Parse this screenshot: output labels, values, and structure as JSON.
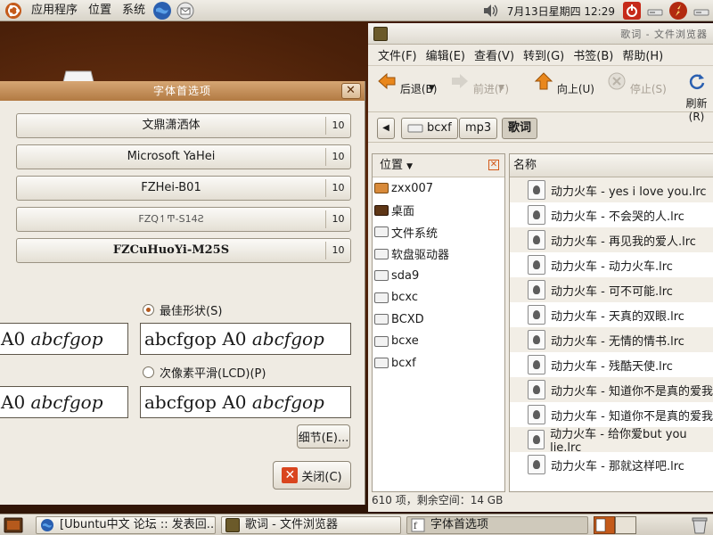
{
  "top_panel": {
    "menus": [
      "应用程序",
      "位置",
      "系统"
    ],
    "clock": "7月13日星期四 12:29"
  },
  "font_prefs": {
    "title": "字体首选项",
    "fonts": [
      {
        "name": "文鼎潇洒体",
        "size": "10"
      },
      {
        "name": "Microsoft YaHei",
        "size": "10"
      },
      {
        "name": "FZHei-B01",
        "size": "10"
      },
      {
        "name": "FZQ↿Ͳ-S14Ƨ",
        "size": "10"
      },
      {
        "name": "FZCuHuoYi-M25S",
        "size": "10"
      }
    ],
    "rendering": {
      "best_shapes": "最佳形状(S)",
      "subpixel": "次像素平滑(LCD)(P)"
    },
    "preview_text_a": "A0 ",
    "preview_text_b": "abcfgop",
    "preview_text_c": "abcfgop ",
    "preview_text_d": "A0 ",
    "details_button": "细节(E)...",
    "close_button": "关闭(C)"
  },
  "file_browser": {
    "title": "歌词 - 文件浏览器",
    "menu": [
      "文件(F)",
      "编辑(E)",
      "查看(V)",
      "转到(G)",
      "书签(B)",
      "帮助(H)"
    ],
    "toolbar": {
      "back": "后退(B)",
      "forward": "前进(F)",
      "up": "向上(U)",
      "stop": "停止(S)",
      "refresh": "刷新(R)"
    },
    "breadcrumbs": [
      "bcxf",
      "mp3",
      "歌词"
    ],
    "sidebar": {
      "header": "位置",
      "items": [
        "zxx007",
        "桌面",
        "文件系统",
        "软盘驱动器",
        "sda9",
        "bcxc",
        "BCXD",
        "bcxe",
        "bcxf"
      ]
    },
    "list": {
      "column": "名称",
      "files": [
        "动力火车 - yes i love you.lrc",
        "动力火车 - 不会哭的人.lrc",
        "动力火车 - 再见我的爱人.lrc",
        "动力火车 - 动力火车.lrc",
        "动力火车 - 可不可能.lrc",
        "动力火车 - 天真的双眼.lrc",
        "动力火车 - 无情的情书.lrc",
        "动力火车 - 残酷天使.lrc",
        "动力火车 - 知道你不是真的爱我",
        "动力火车 - 知道你不是真的爱我",
        "动力火车 - 给你爱but you lie.lrc",
        "动力火车 - 那就这样吧.lrc"
      ]
    },
    "status": "610 项，剩余空间：14 GB"
  },
  "taskbar": {
    "tasks": [
      "[Ubuntu中文 论坛 :: 发表回...",
      "歌词 - 文件浏览器",
      "字体首选项"
    ]
  }
}
